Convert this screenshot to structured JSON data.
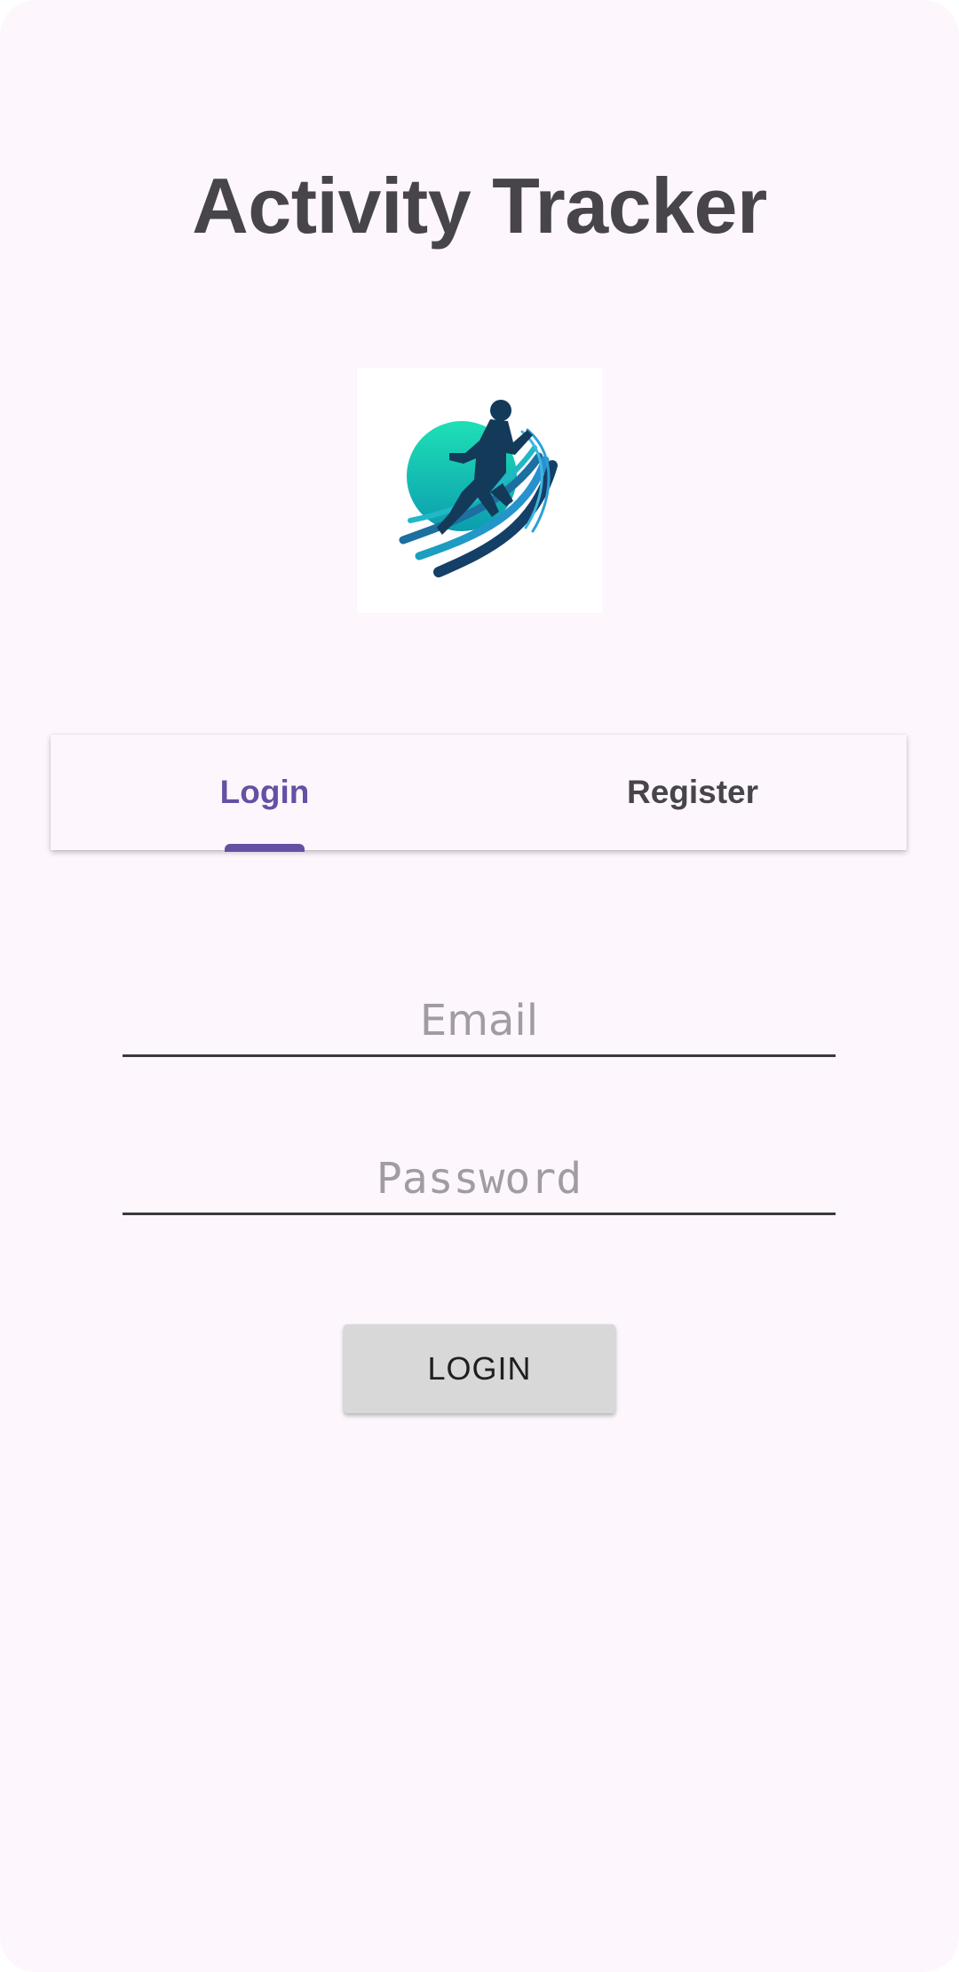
{
  "app": {
    "title": "Activity Tracker",
    "logo_icon": "runner-logo-icon"
  },
  "tabs": [
    {
      "label": "Login",
      "active": true
    },
    {
      "label": "Register",
      "active": false
    }
  ],
  "form": {
    "email": {
      "value": "",
      "placeholder": "Email"
    },
    "password": {
      "value": "",
      "placeholder": "Password"
    },
    "login_button_label": "LOGIN"
  },
  "colors": {
    "background": "#fdf7fd",
    "accent": "#6650a4",
    "title": "#48444c",
    "button": "#d8d8d8"
  }
}
